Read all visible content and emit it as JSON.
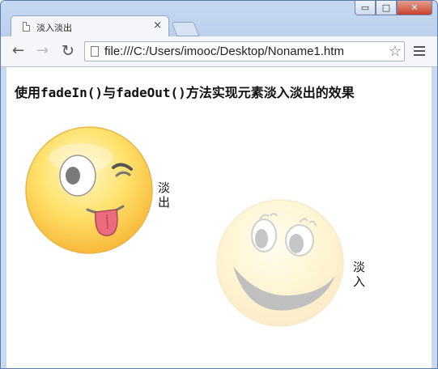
{
  "window": {
    "tab_title": "淡入淡出",
    "tab_close": "×",
    "controls": {
      "minimize": "▭",
      "maximize": "□",
      "close": "✕"
    }
  },
  "toolbar": {
    "back_icon": "←",
    "forward_icon": "→",
    "reload_icon": "↻",
    "url": "file:///C:/Users/imooc/Desktop/Noname1.htm",
    "star_icon": "☆"
  },
  "page": {
    "heading": "使用fadeIn()与fadeOut()方法实现元素淡入淡出的效果",
    "fade_out_label": "淡出",
    "fade_in_label": "淡入",
    "wink_smiley_opacity": 1,
    "happy_smiley_opacity": 0.28
  },
  "colors": {
    "smiley_yellow": "#ffd24a",
    "smiley_light": "#fff6c2",
    "tongue": "#e8647a"
  }
}
